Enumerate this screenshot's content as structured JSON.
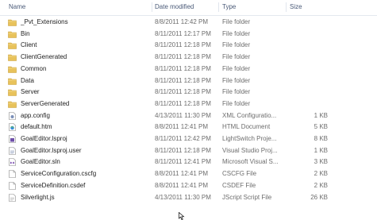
{
  "columns": {
    "name": "Name",
    "date": "Date modified",
    "type": "Type",
    "size": "Size"
  },
  "files": [
    {
      "name": "_Pvt_Extensions",
      "date": "8/8/2011 12:42 PM",
      "type": "File folder",
      "size": "",
      "icon": "folder-icon"
    },
    {
      "name": "Bin",
      "date": "8/11/2011 12:17 PM",
      "type": "File folder",
      "size": "",
      "icon": "folder-icon"
    },
    {
      "name": "Client",
      "date": "8/11/2011 12:18 PM",
      "type": "File folder",
      "size": "",
      "icon": "folder-icon"
    },
    {
      "name": "ClientGenerated",
      "date": "8/11/2011 12:18 PM",
      "type": "File folder",
      "size": "",
      "icon": "folder-icon"
    },
    {
      "name": "Common",
      "date": "8/11/2011 12:18 PM",
      "type": "File folder",
      "size": "",
      "icon": "folder-icon"
    },
    {
      "name": "Data",
      "date": "8/11/2011 12:18 PM",
      "type": "File folder",
      "size": "",
      "icon": "folder-icon"
    },
    {
      "name": "Server",
      "date": "8/11/2011 12:18 PM",
      "type": "File folder",
      "size": "",
      "icon": "folder-icon"
    },
    {
      "name": "ServerGenerated",
      "date": "8/11/2011 12:18 PM",
      "type": "File folder",
      "size": "",
      "icon": "folder-icon"
    },
    {
      "name": "app.config",
      "date": "4/13/2011 11:30 PM",
      "type": "XML Configuratio...",
      "size": "1 KB",
      "icon": "config-file-icon"
    },
    {
      "name": "default.htm",
      "date": "8/8/2011 12:41 PM",
      "type": "HTML Document",
      "size": "5 KB",
      "icon": "html-file-icon"
    },
    {
      "name": "GoalEditor.lsproj",
      "date": "8/11/2011 12:42 PM",
      "type": "LightSwitch Proje...",
      "size": "8 KB",
      "icon": "lightswitch-project-icon"
    },
    {
      "name": "GoalEditor.lsproj.user",
      "date": "8/11/2011 12:18 PM",
      "type": "Visual Studio Proj...",
      "size": "1 KB",
      "icon": "vs-user-file-icon"
    },
    {
      "name": "GoalEditor.sln",
      "date": "8/11/2011 12:41 PM",
      "type": "Microsoft Visual S...",
      "size": "3 KB",
      "icon": "solution-file-icon"
    },
    {
      "name": "ServiceConfiguration.cscfg",
      "date": "8/8/2011 12:41 PM",
      "type": "CSCFG File",
      "size": "2 KB",
      "icon": "generic-file-icon"
    },
    {
      "name": "ServiceDefinition.csdef",
      "date": "8/8/2011 12:41 PM",
      "type": "CSDEF File",
      "size": "2 KB",
      "icon": "generic-file-icon"
    },
    {
      "name": "Silverlight.js",
      "date": "4/13/2011 11:30 PM",
      "type": "JScript Script File",
      "size": "26 KB",
      "icon": "script-file-icon"
    }
  ]
}
